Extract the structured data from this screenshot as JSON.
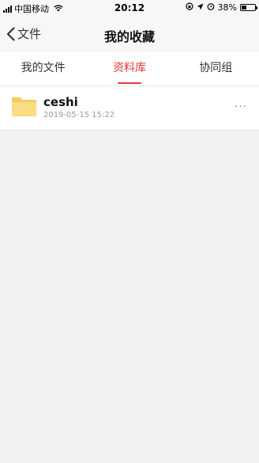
{
  "status_bar": {
    "carrier": "中国移动",
    "time": "20:12",
    "battery_percent": "38%",
    "battery_level": 0.38
  },
  "nav": {
    "back_label": "文件",
    "title": "我的收藏"
  },
  "tabs": [
    {
      "label": "我的文件",
      "active": false
    },
    {
      "label": "资料库",
      "active": true
    },
    {
      "label": "协同组",
      "active": false
    }
  ],
  "files": [
    {
      "name": "ceshi",
      "date": "2019-05-15 15:22",
      "icon": "folder-icon",
      "more": "···"
    }
  ],
  "colors": {
    "accent": "#e23a3a",
    "folder": "#f7d774",
    "background": "#f2f2f4"
  }
}
